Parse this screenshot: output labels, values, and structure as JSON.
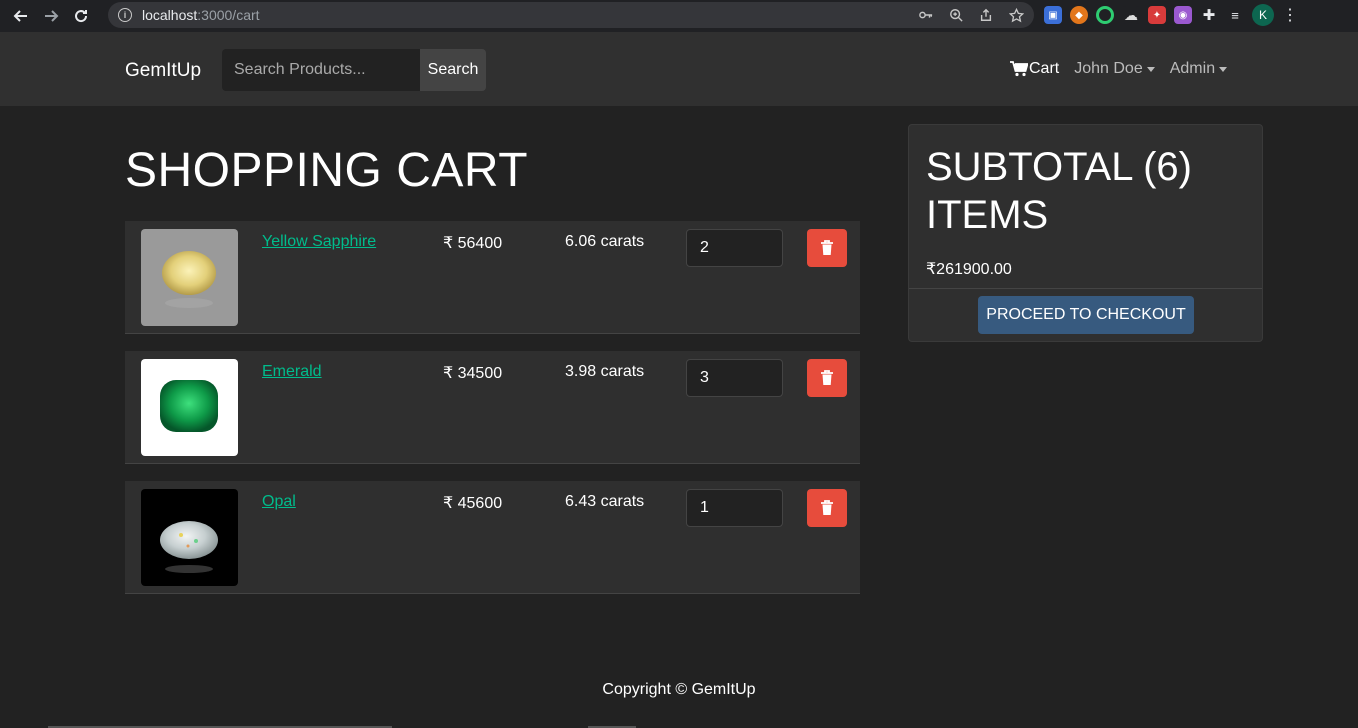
{
  "browser": {
    "url_host": "localhost",
    "url_path": ":3000/cart",
    "avatar_letter": "K"
  },
  "navbar": {
    "brand": "GemItUp",
    "search_placeholder": "Search Products...",
    "search_button": "Search",
    "cart_label": "Cart",
    "user_menu": "John Doe",
    "admin_menu": "Admin"
  },
  "cart": {
    "title": "SHOPPING CART",
    "items": [
      {
        "name": "Yellow Sapphire",
        "price": "₹ 56400",
        "carats": "6.06 carats",
        "qty": "2"
      },
      {
        "name": "Emerald",
        "price": "₹ 34500",
        "carats": "3.98 carats",
        "qty": "3"
      },
      {
        "name": "Opal",
        "price": "₹ 45600",
        "carats": "6.43 carats",
        "qty": "1"
      }
    ]
  },
  "summary": {
    "title": "SUBTOTAL (6) ITEMS",
    "amount": "₹261900.00",
    "checkout": "PROCEED TO CHECKOUT"
  },
  "footer": {
    "copyright": "Copyright © GemItUp"
  },
  "colors": {
    "accent_link": "#00bc8c",
    "danger": "#e74c3c",
    "primary": "#375a7f"
  }
}
